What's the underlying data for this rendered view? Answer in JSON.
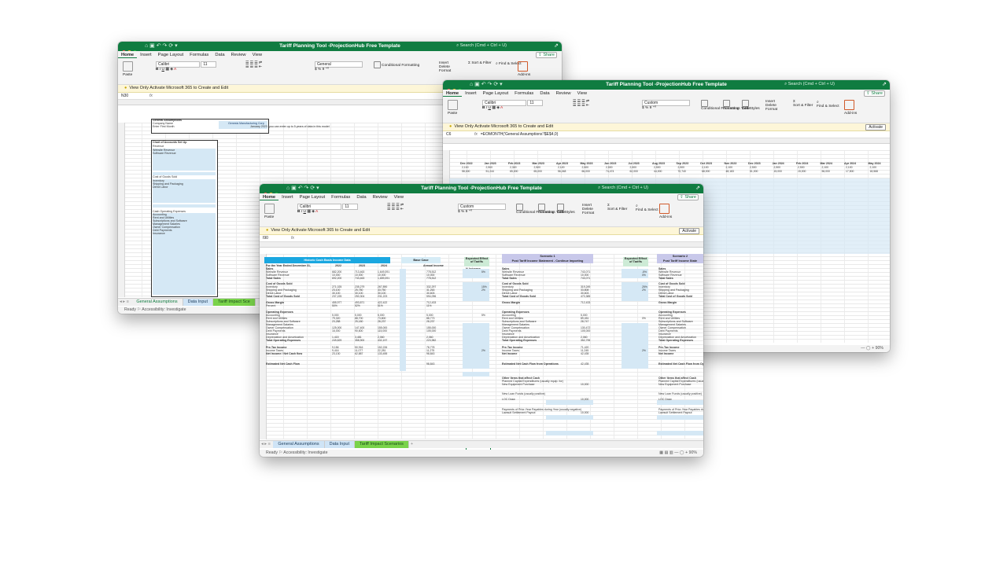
{
  "windows": {
    "w1": {
      "title": "Tariff Planning Tool -ProjectionHub Free Template",
      "search": "Search (Cmd + Ctrl + U)",
      "menu": [
        "Home",
        "Insert",
        "Page Layout",
        "Formulas",
        "Data",
        "Review",
        "View"
      ],
      "share": "Share",
      "font": "Calibri",
      "font_size": "11",
      "number_format": "General",
      "ribbon_labels": {
        "paste": "Paste",
        "cond": "Conditional Formatting",
        "fmt_table": "Format as Table",
        "cell_styles": "Cell Styles",
        "insert": "Insert",
        "delete": "Delete",
        "format": "Format",
        "sort": "Sort & Filter",
        "find": "Find & Select",
        "addins": "Add-ins"
      },
      "notice": "View Only  Activate Microsoft 365 to Create and Edit",
      "cell_ref": "N30",
      "sheet_content": {
        "general_assumptions": "General Assumptions",
        "company_name_label": "Company Name",
        "company_name_value": "Genesis Manufacturing Corp",
        "first_month_label": "Enter First Month",
        "first_month_value": "January 2023",
        "first_month_note": "you can enter up to 5 years of data in this model",
        "chart_of_accounts": "Chart of Accounts Set Up",
        "revenue": "Revenue",
        "website_revenue": "Website Revenue",
        "software_revenue": "Software Revenue",
        "cogs": "Cost of Goods Sold",
        "inventory": "Inventory",
        "shipping": "Shipping and Packaging",
        "direct_labor": "Direct Labor",
        "cash_opex": "Cash Operating Expenses",
        "opex_items": [
          "Accounting",
          "Rent and Utilities",
          "Subscriptions and Software",
          "Management Salaries",
          "Owner Compensation",
          "Debt Payments",
          "Insurance"
        ]
      },
      "tabs": [
        "General Assumptions",
        "Data Input",
        "Tariff Impact Sce"
      ],
      "status": "Ready",
      "accessibility": "Accessibility: Investigate"
    },
    "w2": {
      "title": "Tariff Planning Tool -ProjectionHub Free Template",
      "search": "Search (Cmd + Ctrl + U)",
      "menu": [
        "Home",
        "Insert",
        "Page Layout",
        "Formulas",
        "Data",
        "Review",
        "View"
      ],
      "share": "Share",
      "font": "Calibri",
      "font_size": "11",
      "number_format": "Custom",
      "ribbon_labels": {
        "paste": "Paste",
        "cond": "Conditional Formatting",
        "fmt_table": "Format as Table",
        "cell_styles": "Cell Styles",
        "insert": "Insert",
        "delete": "Delete",
        "format": "Format",
        "sort": "Sort & Filter",
        "find": "Find & Select",
        "addins": "Add-ins"
      },
      "notice": "View Only  Activate Microsoft 365 to Create and Edit",
      "activate": "Activate",
      "cell_ref": "C6",
      "formula": "=EOMONTH('General Assumptions'!$E$4,0)",
      "months": [
        "Dec 2022",
        "Jan 2023",
        "Feb 2023",
        "Mar 2023",
        "Apr 2023",
        "May 2023",
        "Jun 2023",
        "Jul 2023",
        "Aug 2023",
        "Sep 2023",
        "Oct 2023",
        "Nov 2023",
        "Dec 2023",
        "Jan 2024",
        "Feb 2024",
        "Mar 2024",
        "Apr 2024",
        "May 2024"
      ],
      "row1": [
        "2,100",
        "2,500",
        "2,300",
        "2,500",
        "2,100",
        "2,500",
        "2,500",
        "2,500",
        "2,500",
        "2,500",
        "2,100",
        "2,100",
        "2,500",
        "2,500",
        "2,500",
        "2,100",
        "2,100",
        "2,100"
      ],
      "row2": [
        "58,000",
        "51,244",
        "65,000",
        "65,000",
        "56,048",
        "66,000",
        "74,474",
        "62,000",
        "44,000",
        "70,740",
        "68,000",
        "48,183",
        "51,000",
        "15,000",
        "15,000",
        "56,000",
        "17,500",
        "18,568"
      ],
      "zoom": "90%"
    },
    "w3": {
      "title": "Tariff Planning Tool -ProjectionHub Free Template",
      "search": "Search (Cmd + Ctrl + U)",
      "menu": [
        "Home",
        "Insert",
        "Page Layout",
        "Formulas",
        "Data",
        "Review",
        "View"
      ],
      "share": "Share",
      "font": "Calibri",
      "font_size": "11",
      "number_format": "Custom",
      "ribbon_labels": {
        "paste": "Paste",
        "cond": "Conditional Formatting",
        "fmt_table": "Format as Table",
        "cell_styles": "Cell Styles",
        "insert": "Insert",
        "delete": "Delete",
        "format": "Format",
        "sort": "Sort & Filter",
        "find": "Find & Select",
        "addins": "Add-ins"
      },
      "notice": "View Only  Activate Microsoft 365 to Create and Edit",
      "activate": "Activate",
      "cell_ref": "I90",
      "headers": {
        "historic": "Historic Cash Basis Income Data",
        "base_case": "Base Case",
        "expected_effect": "Expected Effect of Tariffs",
        "scenario1": "Scenario 1",
        "post_tariff": "Post Tariff Income Statement - Continue Importing",
        "scenario2": "Scenario 2",
        "post_tariff_short": "Post Tariff Income State"
      },
      "years": [
        "2022",
        "2023",
        "2024"
      ],
      "period_label": "For the Year Ended December 31,",
      "annual_income": "Annual Income",
      "pct_increase": "% Increase",
      "sales": "Sales",
      "sales_items": [
        "Website Revenue",
        "Software Revenue",
        "Total Sales"
      ],
      "cogs": "Cost of Goods Sold",
      "cogs_items": [
        "Inventory",
        "Shipping and Packaging",
        "Direct Labor",
        "Total Cost of Goods Sold"
      ],
      "gross_margin": "Gross Margin",
      "percent": "Percent",
      "opex": "Operating Expenses",
      "opex_items": [
        "Accounting",
        "Rent and Utilities",
        "Subscriptions and Software",
        "Management Salaries",
        "Owner Compensation",
        "Debt Payments",
        "Insurance",
        "Depreciation and Amortization",
        "Total Operating Expenses"
      ],
      "pretax": "Pre-Tax Income",
      "income_taxes": "Income Taxes",
      "net_income_label": "Net Income / Net Cash flow",
      "net_income": "Net Income",
      "est_cash_flow": "Estimated Net Cash Flow",
      "est_cash_flow_ops": "Estimated Net Cash Flow from Operations",
      "other_items": "Other Items that affect Cash",
      "planned_capex": "Planned Capital Expenditures (usually equip. for)",
      "new_equipment": "New Equipment Purchase",
      "new_loan": "New Loan Funds  (usually positive)",
      "loc_draw": "LOC Draw",
      "payments_prior": "Payments of Prior-Year Payables during Year (usually negative)",
      "lawsuit": "Lawsuit Settlement Payout",
      "hist_vals": {
        "website": [
          "682,200",
          "713,463",
          "1,649,391"
        ],
        "software": [
          "10,000",
          "10,000",
          "10,000"
        ],
        "total_sales": [
          "692,200",
          "743,463",
          "1,659,391"
        ],
        "inventory": [
          "271,025",
          "235,279",
          "267,890"
        ],
        "shipping": [
          "23,100",
          "25,780",
          "33,750"
        ],
        "labor": [
          "30,100",
          "30,100",
          "30,100"
        ],
        "total_cogs": [
          "237,225",
          "250,304",
          "231,223"
        ],
        "gm": [
          "455,977",
          "493,871",
          "422,422"
        ],
        "pct": [
          "50%",
          "52%",
          "51%"
        ],
        "accounting": [
          "5,000",
          "5,000",
          "5,000"
        ],
        "rent": [
          "79,320",
          "88,700",
          "73,800"
        ],
        "subs": [
          "23,288",
          "25,180",
          "28,237"
        ],
        "owner": [
          "125,000",
          "147,400",
          "155,000"
        ],
        "debt": [
          "16,000",
          "90,600",
          "115,000"
        ],
        "dep": [
          "1,415",
          "3,481",
          "2,060"
        ],
        "total_opex": [
          "249,829",
          "358,900",
          "432,197"
        ],
        "pretax": [
          "9,156",
          "50,916",
          "152,226"
        ],
        "taxes": [
          "9,416",
          "11,077",
          "22,281"
        ],
        "net": [
          "23,130",
          "62,887",
          "133,455"
        ]
      },
      "base_vals": [
        "778,512",
        "10,000",
        "778,512",
        "332,297",
        "31,263",
        "30,603",
        "594,096",
        "712,433",
        "11%",
        "5,000",
        "88,773",
        "28,237",
        "155,000",
        "105,000",
        "2,060",
        "223,982",
        "78,778",
        "11,275",
        "98,843",
        "98,843"
      ],
      "effect_pct": [
        "5%",
        "15%",
        "2%",
        "5%",
        "2%"
      ],
      "scn1_vals": [
        "743,071",
        "10,000",
        "743,071",
        "319,249",
        "33,808",
        "30,603",
        "470,385",
        "712,433",
        "5,000",
        "89,451",
        "28,747",
        "130,472",
        "105,000",
        "2,060",
        "352,795",
        "71,420",
        "11,245",
        "42,435",
        "42,435",
        "10,000",
        "10,000",
        "10,000"
      ],
      "effect2_pct": [
        "-5%",
        "0%",
        "25%",
        "2%",
        "0%",
        "2%"
      ],
      "tabs": [
        "General Assumptions",
        "Data Input",
        "Tariff Impact Scenarios"
      ],
      "status": "Ready",
      "accessibility": "Accessibility: Investigate",
      "zoom": "90%"
    }
  },
  "colors": {
    "excel_green": "#107c41",
    "band_blue": "#d5e8f5",
    "header_cyan": "#1aa7e0",
    "header_lav": "#c8c8ea",
    "header_mint": "#cdebd6",
    "header_light": "#d6ecf6"
  }
}
